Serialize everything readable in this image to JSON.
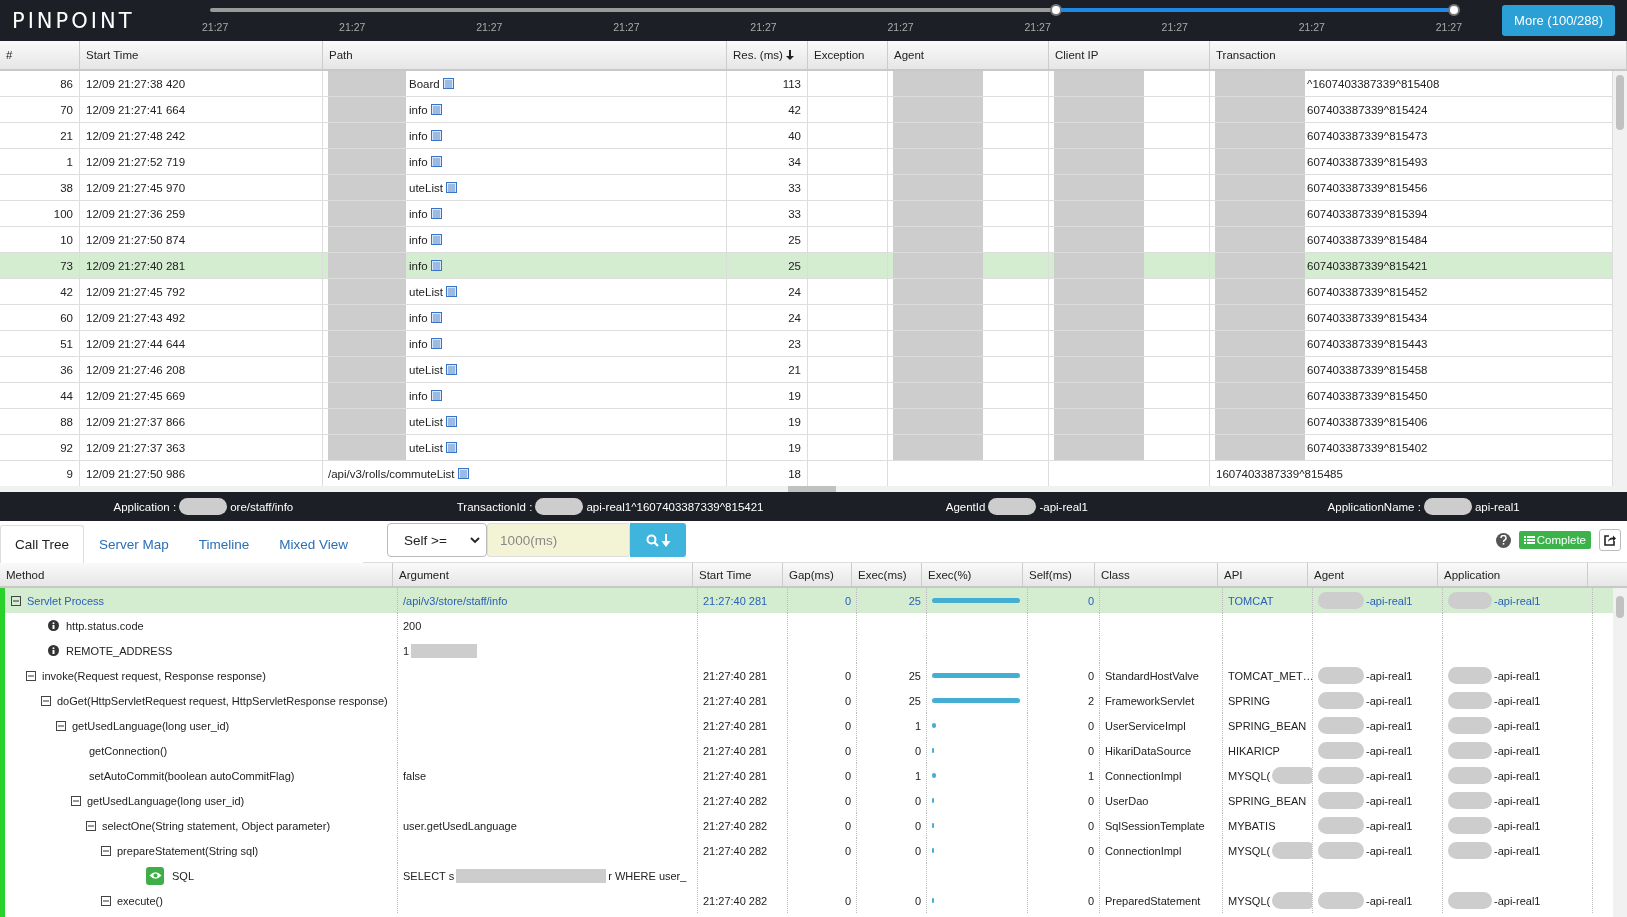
{
  "logo": "PINPOINT",
  "timeline": {
    "ticks": [
      "21:27",
      "21:27",
      "21:27",
      "21:27",
      "21:27",
      "21:27",
      "21:27",
      "21:27",
      "21:27",
      "21:27"
    ],
    "handles": [
      {
        "level": 0.68
      },
      {
        "level": 1
      }
    ]
  },
  "more_button": "More (100/288)",
  "list": {
    "columns": [
      {
        "label": "#",
        "sorted": false,
        "redacted": false
      },
      {
        "label": "Start Time",
        "sorted": false,
        "redacted": false
      },
      {
        "label": "Path",
        "sorted": false,
        "redacted": true
      },
      {
        "label": "Res. (ms)",
        "sorted": true,
        "redacted": false
      },
      {
        "label": "Exception",
        "sorted": false,
        "redacted": false
      },
      {
        "label": "Agent",
        "sorted": false,
        "redacted": true
      },
      {
        "label": "Client IP",
        "sorted": false,
        "redacted": true
      },
      {
        "label": "Transaction",
        "sorted": false,
        "redacted": true
      }
    ],
    "rows": [
      {
        "cells": [
          "86",
          "12/09 21:27:38 420",
          "Board",
          "113",
          "",
          "",
          "",
          "^1607403387339^815408"
        ],
        "selected": false
      },
      {
        "cells": [
          "70",
          "12/09 21:27:41 664",
          "info",
          "42",
          "",
          "",
          "",
          "607403387339^815424"
        ],
        "selected": false
      },
      {
        "cells": [
          "21",
          "12/09 21:27:48 242",
          "info",
          "40",
          "",
          "",
          "",
          "607403387339^815473"
        ],
        "selected": false
      },
      {
        "cells": [
          "1",
          "12/09 21:27:52 719",
          "info",
          "34",
          "",
          "",
          "",
          "607403387339^815493"
        ],
        "selected": false
      },
      {
        "cells": [
          "38",
          "12/09 21:27:45 970",
          "uteList",
          "33",
          "",
          "",
          "",
          "607403387339^815456"
        ],
        "selected": false
      },
      {
        "cells": [
          "100",
          "12/09 21:27:36 259",
          "info",
          "33",
          "",
          "",
          "",
          "607403387339^815394"
        ],
        "selected": false
      },
      {
        "cells": [
          "10",
          "12/09 21:27:50 874",
          "info",
          "25",
          "",
          "",
          "",
          "607403387339^815484"
        ],
        "selected": false
      },
      {
        "cells": [
          "73",
          "12/09 21:27:40 281",
          "info",
          "25",
          "",
          "",
          "",
          "607403387339^815421"
        ],
        "selected": true
      },
      {
        "cells": [
          "42",
          "12/09 21:27:45 792",
          "uteList",
          "24",
          "",
          "",
          "",
          "607403387339^815452"
        ],
        "selected": false
      },
      {
        "cells": [
          "60",
          "12/09 21:27:43 492",
          "info",
          "24",
          "",
          "",
          "",
          "607403387339^815434"
        ],
        "selected": false
      },
      {
        "cells": [
          "51",
          "12/09 21:27:44 644",
          "info",
          "23",
          "",
          "",
          "",
          "607403387339^815443"
        ],
        "selected": false
      },
      {
        "cells": [
          "36",
          "12/09 21:27:46 208",
          "uteList",
          "21",
          "",
          "",
          "",
          "607403387339^815458"
        ],
        "selected": false
      },
      {
        "cells": [
          "44",
          "12/09 21:27:45 669",
          "info",
          "19",
          "",
          "",
          "",
          "607403387339^815450"
        ],
        "selected": false
      },
      {
        "cells": [
          "88",
          "12/09 21:27:37 866",
          "uteList",
          "19",
          "",
          "",
          "",
          "607403387339^815406"
        ],
        "selected": false
      },
      {
        "cells": [
          "92",
          "12/09 21:27:37 363",
          "uteList",
          "19",
          "",
          "",
          "",
          "607403387339^815402"
        ],
        "selected": false
      },
      {
        "cells": [
          "9",
          "12/09 21:27:50 986",
          "/api/v3/rolls/commuteList",
          "18",
          "",
          "",
          "",
          "1607403387339^815485"
        ],
        "selected": false
      }
    ]
  },
  "info_bar": [
    {
      "label": "Application :",
      "value": "ore/staff/info"
    },
    {
      "label": "TransactionId :",
      "value": "api-real1^1607403387339^815421"
    },
    {
      "label": "AgentId",
      "value": "-api-real1"
    },
    {
      "label": "ApplicationName :",
      "value": "api-real1"
    }
  ],
  "tabs": [
    {
      "label": "Call Tree",
      "selected": true
    },
    {
      "label": "Server Map",
      "selected": false
    },
    {
      "label": "Timeline",
      "selected": false
    },
    {
      "label": "Mixed View",
      "selected": false
    }
  ],
  "filter": {
    "select": "Self >=",
    "placeholder": "1000(ms)"
  },
  "complete_button": "Complete",
  "call_tree": {
    "columns": [
      "Method",
      "Argument",
      "Start Time",
      "Gap(ms)",
      "Exec(ms)",
      "Exec(%)",
      "Self(ms)",
      "Class",
      "API",
      "Agent",
      "Application"
    ],
    "rows": [
      {
        "kind": "method",
        "method": "Servlet Process",
        "argument": "/api/v3/store/staff/info",
        "start": "21:27:40 281",
        "gap": "0",
        "exec": "25",
        "level": 1,
        "self": "0",
        "class": "",
        "api": "TOMCAT",
        "agent": "-api-real1",
        "application": "-api-real1",
        "selected": true,
        "expanded": true,
        "children": [
          {
            "kind": "info",
            "method": "http.status.code",
            "argument": "200",
            "selected": false
          },
          {
            "kind": "info",
            "method": "REMOTE_ADDRESS",
            "argument": "1",
            "argument_redacted": true,
            "selected": false
          },
          {
            "kind": "method",
            "method": "invoke(Request request, Response response)",
            "start": "21:27:40 281",
            "gap": "0",
            "exec": "25",
            "level": 1,
            "self": "0",
            "class": "StandardHostValve",
            "api": "TOMCAT_MET…",
            "agent": "-api-real1",
            "application": "-api-real1",
            "selected": false,
            "expanded": true,
            "children": [
              {
                "kind": "method",
                "method": "doGet(HttpServletRequest request, HttpServletResponse response)",
                "start": "21:27:40 281",
                "gap": "0",
                "exec": "25",
                "level": 1,
                "self": "2",
                "class": "FrameworkServlet",
                "api": "SPRING",
                "agent": "-api-real1",
                "application": "-api-real1",
                "selected": false,
                "expanded": true,
                "children": [
                  {
                    "kind": "method",
                    "method": "getUsedLanguage(long user_id)",
                    "start": "21:27:40 281",
                    "gap": "0",
                    "exec": "1",
                    "level": 0.04,
                    "self": "0",
                    "class": "UserServiceImpl",
                    "api": "SPRING_BEAN",
                    "agent": "-api-real1",
                    "application": "-api-real1",
                    "selected": false,
                    "expanded": true,
                    "children": [
                      {
                        "kind": "method",
                        "method": "getConnection()",
                        "start": "21:27:40 281",
                        "gap": "0",
                        "exec": "0",
                        "level": 0.005,
                        "self": "0",
                        "class": "HikariDataSource",
                        "api": "HIKARICP",
                        "agent": "-api-real1",
                        "application": "-api-real1",
                        "selected": false
                      },
                      {
                        "kind": "method",
                        "method": "setAutoCommit(boolean autoCommitFlag)",
                        "argument": "false",
                        "start": "21:27:40 281",
                        "gap": "0",
                        "exec": "1",
                        "level": 0.04,
                        "self": "1",
                        "class": "ConnectionImpl",
                        "api": "MYSQL(",
                        "api_redacted": true,
                        "agent": "-api-real1",
                        "application": "-api-real1",
                        "selected": false
                      },
                      {
                        "kind": "method",
                        "method": "getUsedLanguage(long user_id)",
                        "start": "21:27:40 282",
                        "gap": "0",
                        "exec": "0",
                        "level": 0.005,
                        "self": "0",
                        "class": "UserDao",
                        "api": "SPRING_BEAN",
                        "agent": "-api-real1",
                        "application": "-api-real1",
                        "selected": false,
                        "expanded": true,
                        "children": [
                          {
                            "kind": "method",
                            "method": "selectOne(String statement, Object parameter)",
                            "argument": "user.getUsedLanguage",
                            "start": "21:27:40 282",
                            "gap": "0",
                            "exec": "0",
                            "level": 0.005,
                            "self": "0",
                            "class": "SqlSessionTemplate",
                            "api": "MYBATIS",
                            "agent": "-api-real1",
                            "application": "-api-real1",
                            "selected": false,
                            "expanded": true,
                            "children": [
                              {
                                "kind": "method",
                                "method": "prepareStatement(String sql)",
                                "start": "21:27:40 282",
                                "gap": "0",
                                "exec": "0",
                                "level": 0.005,
                                "self": "0",
                                "class": "ConnectionImpl",
                                "api": "MYSQL(",
                                "api_redacted": true,
                                "agent": "-api-real1",
                                "application": "-api-real1",
                                "selected": false,
                                "expanded": true,
                                "children": [
                                  {
                                    "kind": "sql",
                                    "method": "SQL",
                                    "argument": "SELECT s",
                                    "argument_redacted": true,
                                    "argument_tail": "r WHERE user_",
                                    "selected": false
                                  }
                                ]
                              },
                              {
                                "kind": "method",
                                "method": "execute()",
                                "start": "21:27:40 282",
                                "gap": "0",
                                "exec": "0",
                                "level": 0.005,
                                "self": "0",
                                "class": "PreparedStatement",
                                "api": "MYSQL(",
                                "api_redacted": true,
                                "agent": "-api-real1",
                                "application": "-api-real1",
                                "selected": false,
                                "expanded": true
                              }
                            ]
                          }
                        ]
                      }
                    ]
                  }
                ]
              }
            ]
          }
        ]
      }
    ]
  }
}
